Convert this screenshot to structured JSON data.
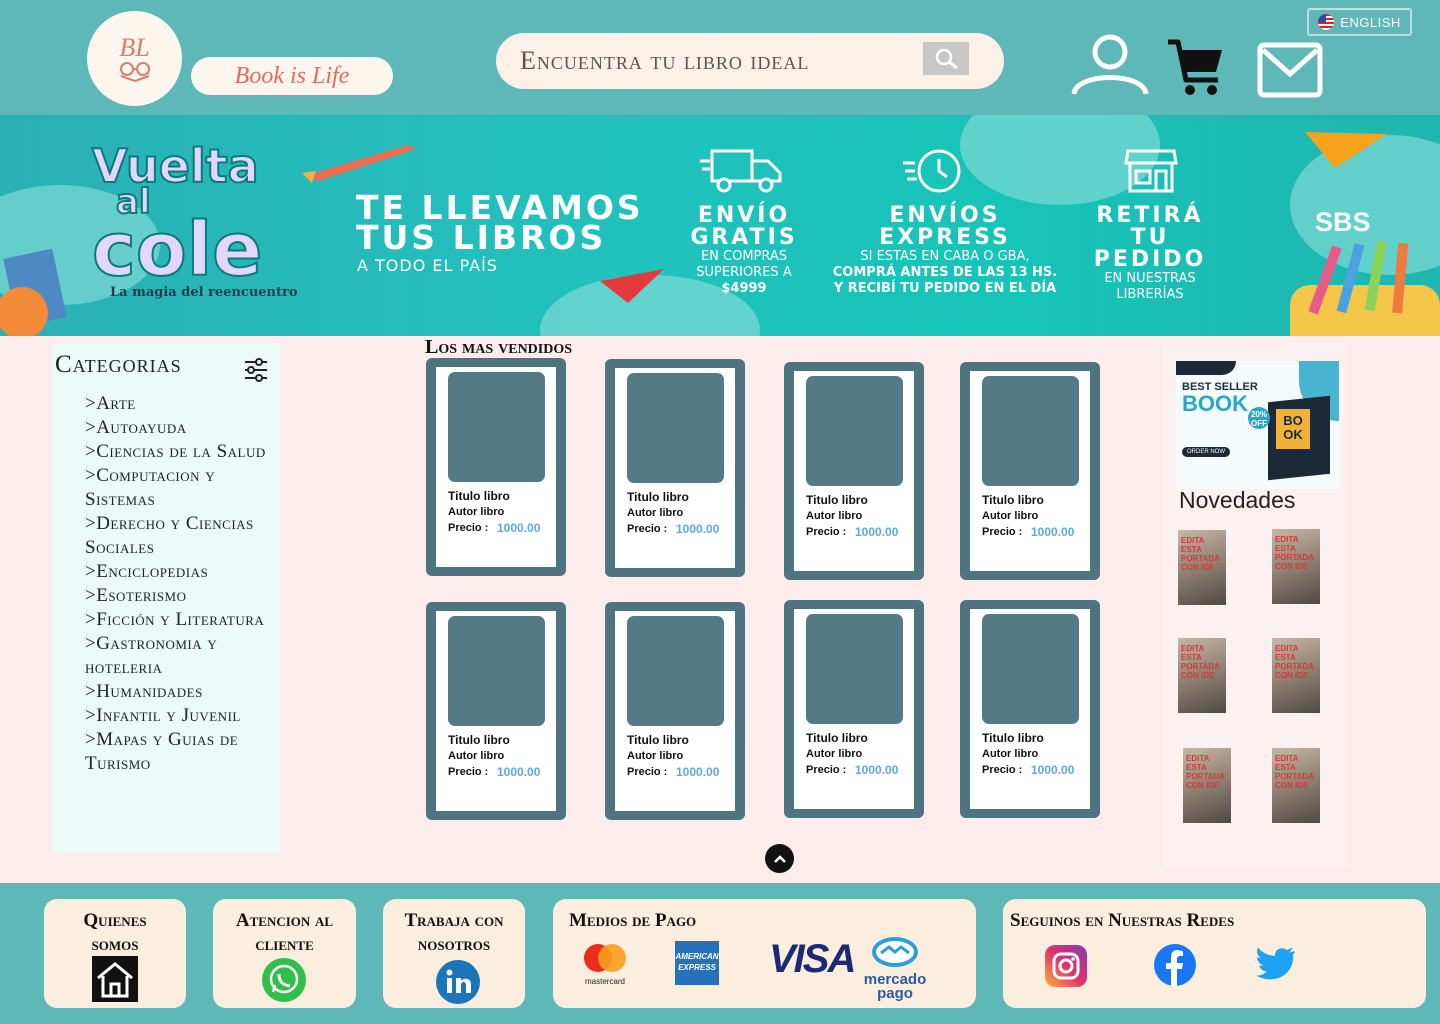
{
  "header": {
    "logo_initials": "BL",
    "brand_name": "Book is Life",
    "search_placeholder": "Encuentra tu libro ideal",
    "language_label": "ENGLISH",
    "icons": [
      "search-icon",
      "user-icon",
      "cart-icon",
      "mail-icon",
      "us-flag-icon"
    ]
  },
  "banner": {
    "campaign_line1": "Vuelta",
    "campaign_line2": "al",
    "campaign_line3": "cole",
    "campaign_tagline": "La magia del reencuentro",
    "headline_1": "TE LLEVAMOS",
    "headline_2": "TUS LIBROS",
    "headline_sub": "A TODO EL PAÍS",
    "col1": {
      "title_1": "ENVÍO",
      "title_2": "GRATIS",
      "text_1": "EN COMPRAS",
      "text_2": "SUPERIORES A",
      "text_3": "$4999"
    },
    "col2": {
      "title_1": "ENVÍOS",
      "title_2": "EXPRESS",
      "text_1": "SI ESTAS EN CABA O GBA,",
      "text_2": "COMPRÁ ANTES DE LAS 13 HS.",
      "text_3": "Y RECIBÍ TU PEDIDO EN EL DÍA"
    },
    "col3": {
      "title_1": "RETIRÁ",
      "title_2": "TU",
      "title_3": "PEDIDO",
      "text_1": "EN NUESTRAS",
      "text_2": "LIBRERÍAS"
    },
    "sponsor": "SBS"
  },
  "sidebar": {
    "title": "Categorias",
    "categories": [
      ">Arte",
      ">Autoayuda",
      ">Ciencias de la Salud",
      ">Computacion y Sistemas",
      ">Derecho y Ciencias Sociales",
      ">Enciclopedias",
      ">Esoterismo",
      ">Ficción y Literatura",
      ">Gastronomia y hoteleria",
      ">Humanidades",
      ">Infantil y Juvenil",
      ">Mapas y Guias de Turismo"
    ]
  },
  "main": {
    "section_title": "Los mas vendidos",
    "products": [
      {
        "title": "Titulo libro",
        "author": "Autor libro",
        "price_label": "Precio :",
        "price": "1000.00"
      },
      {
        "title": "Titulo libro",
        "author": "Autor libro",
        "price_label": "Precio :",
        "price": "1000.00"
      },
      {
        "title": "Titulo libro",
        "author": "Autor libro",
        "price_label": "Precio :",
        "price": "1000.00"
      },
      {
        "title": "Titulo libro",
        "author": "Autor libro",
        "price_label": "Precio :",
        "price": "1000.00"
      },
      {
        "title": "Titulo libro",
        "author": "Autor libro",
        "price_label": "Precio :",
        "price": "1000.00"
      },
      {
        "title": "Titulo libro",
        "author": "Autor libro",
        "price_label": "Precio :",
        "price": "1000.00"
      },
      {
        "title": "Titulo libro",
        "author": "Autor libro",
        "price_label": "Precio :",
        "price": "1000.00"
      },
      {
        "title": "Titulo libro",
        "author": "Autor libro",
        "price_label": "Precio :",
        "price": "1000.00"
      }
    ]
  },
  "right_panel": {
    "promo": {
      "line1": "BEST SELLER",
      "line2": "BOOK",
      "discount": "20% OFF",
      "cover_text": "BO OK",
      "button": "ORDER NOW"
    },
    "news_title": "Novedades",
    "news_thumb_text": "EDITA ESTA PORTADA CON IDE"
  },
  "footer": {
    "about": "Quienes somos",
    "support": "Atencion al cliente",
    "jobs": "Trabaja con nosotros",
    "payments_title": "Medios de Pago",
    "payments": [
      "mastercard",
      "AMERICAN EXPRESS",
      "VISA",
      "mercado pago"
    ],
    "social_title": "Seguinos en Nuestras Redes",
    "social_icons": [
      "instagram-icon",
      "facebook-icon",
      "twitter-icon"
    ]
  },
  "colors": {
    "header_teal": "#5fb8b8",
    "page_bg": "#fcecec",
    "card_slate": "#4f7481",
    "price_blue": "#5aa9e0",
    "footer_box": "#fbeedf"
  }
}
